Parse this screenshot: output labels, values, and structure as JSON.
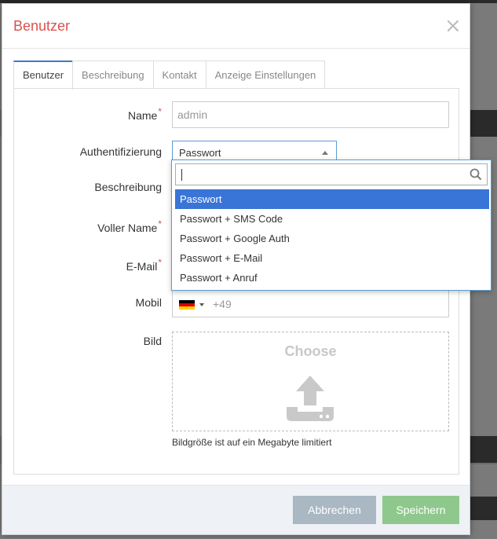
{
  "modal": {
    "title": "Benutzer",
    "close_icon": "close-icon"
  },
  "tabs": [
    {
      "label": "Benutzer",
      "active": true
    },
    {
      "label": "Beschreibung",
      "active": false
    },
    {
      "label": "Kontakt",
      "active": false
    },
    {
      "label": "Anzeige Einstellungen",
      "active": false
    }
  ],
  "form": {
    "name": {
      "label": "Name",
      "required": "*",
      "value": "admin"
    },
    "auth": {
      "label": "Authentifizierung",
      "value": "Passwort"
    },
    "description": {
      "label": "Beschreibung"
    },
    "full_name": {
      "label": "Voller Name",
      "required": "*"
    },
    "email": {
      "label": "E-Mail",
      "required": "*"
    },
    "mobile": {
      "label": "Mobil",
      "country_code": "+49",
      "flag": "germany-flag-icon"
    },
    "image": {
      "label": "Bild",
      "upload_title": "Choose",
      "hint": "Bildgröße ist auf ein Megabyte limitiert",
      "icon": "upload-icon"
    }
  },
  "dropdown": {
    "search_value": "",
    "search_icon": "search-icon",
    "options": [
      {
        "label": "Passwort",
        "selected": true
      },
      {
        "label": "Passwort + SMS Code",
        "selected": false
      },
      {
        "label": "Passwort + Google Auth",
        "selected": false
      },
      {
        "label": "Passwort + E-Mail",
        "selected": false
      },
      {
        "label": "Passwort + Anruf",
        "selected": false
      }
    ]
  },
  "footer": {
    "cancel_label": "Abbrechen",
    "save_label": "Speichern"
  },
  "colors": {
    "title": "#d9534f",
    "accent": "#3a7bc8",
    "selected_option": "#3875d7",
    "cancel_button": "#a9b8c3",
    "save_button": "#8fc88c"
  }
}
